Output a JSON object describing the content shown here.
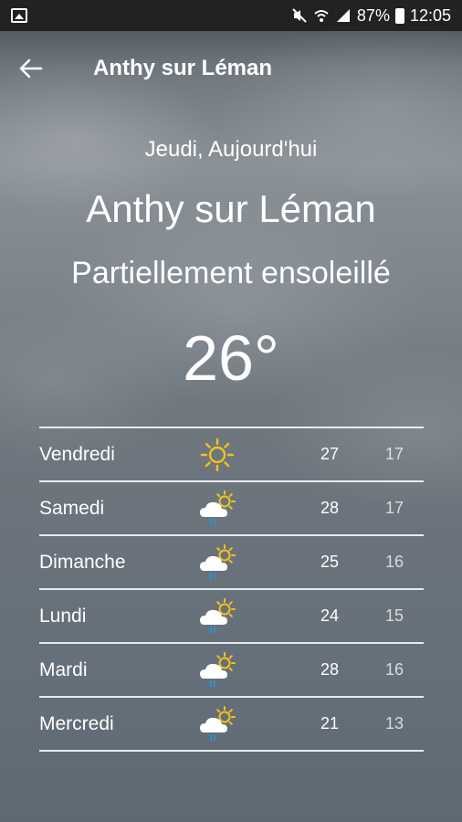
{
  "status_bar": {
    "battery": "87%",
    "time": "12:05"
  },
  "app_bar": {
    "title": "Anthy sur Léman"
  },
  "current": {
    "date": "Jeudi, Aujourd'hui",
    "city": "Anthy sur Léman",
    "condition": "Partiellement ensoleillé",
    "temperature": "26°"
  },
  "forecast": [
    {
      "day": "Vendredi",
      "icon": "sun-icon",
      "high": "27",
      "low": "17"
    },
    {
      "day": "Samedi",
      "icon": "partly-sunny-rain-icon",
      "high": "28",
      "low": "17"
    },
    {
      "day": "Dimanche",
      "icon": "partly-sunny-rain-icon",
      "high": "25",
      "low": "16"
    },
    {
      "day": "Lundi",
      "icon": "partly-sunny-rain-icon",
      "high": "24",
      "low": "15"
    },
    {
      "day": "Mardi",
      "icon": "partly-sunny-rain-icon",
      "high": "28",
      "low": "16"
    },
    {
      "day": "Mercredi",
      "icon": "partly-sunny-rain-icon",
      "high": "21",
      "low": "13"
    }
  ],
  "colors": {
    "sun": "#f2c21b",
    "rain": "#2f8fd6",
    "statusbar": "#222222"
  }
}
